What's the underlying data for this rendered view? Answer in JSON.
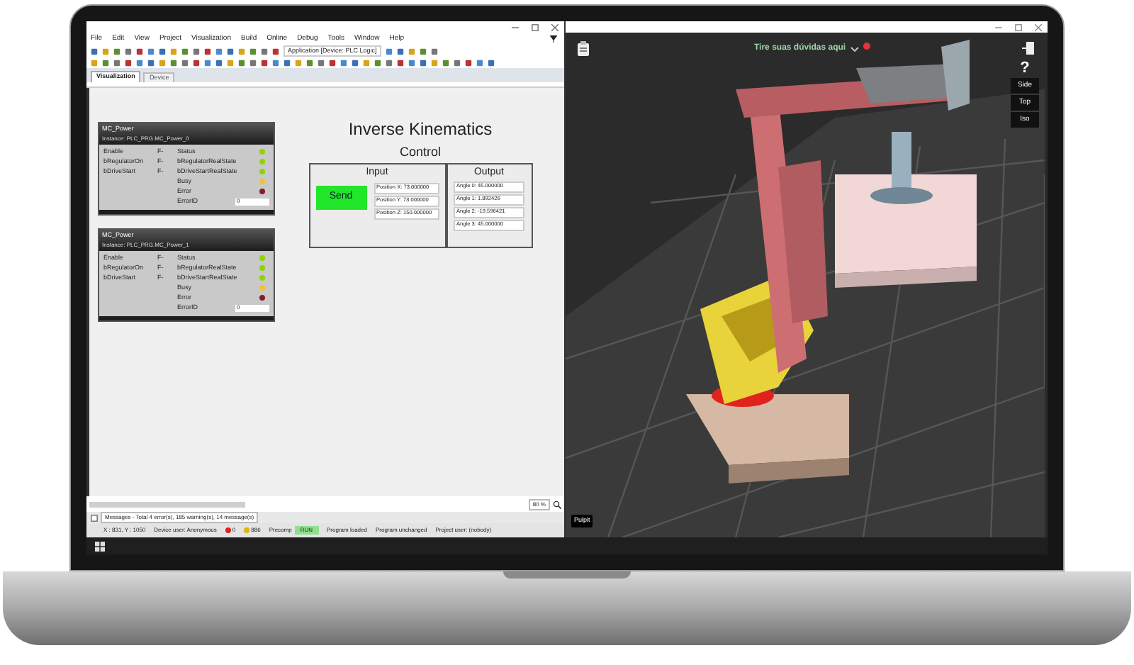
{
  "ide": {
    "menu": [
      "File",
      "Edit",
      "View",
      "Project",
      "Visualization",
      "Build",
      "Online",
      "Debug",
      "Tools",
      "Window",
      "Help"
    ],
    "application": "Application [Device: PLC Logic]",
    "tabs": [
      {
        "label": "Visualization",
        "selected": true
      },
      {
        "label": "Device",
        "selected": false
      }
    ],
    "function_blocks": [
      {
        "title": "MC_Power",
        "instance": "Instance: PLC_PRG.MC_Power_0",
        "inputs": [
          {
            "name": "Enable",
            "value": "F-"
          },
          {
            "name": "bRegulatorOn",
            "value": "F-"
          },
          {
            "name": "bDriveStart",
            "value": "F-"
          }
        ],
        "outputs": [
          {
            "name": "Status",
            "color": "#8fd400"
          },
          {
            "name": "bRegulatorRealState",
            "color": "#8fd400"
          },
          {
            "name": "bDriveStartRealState",
            "color": "#8fd400"
          },
          {
            "name": "Busy",
            "color": "#f2c12e"
          },
          {
            "name": "Error",
            "color": "#8b1a2a"
          }
        ],
        "error_label": "ErrorID",
        "error_value": "0"
      },
      {
        "title": "MC_Power",
        "instance": "Instance: PLC_PRG.MC_Power_1",
        "inputs": [
          {
            "name": "Enable",
            "value": "F-"
          },
          {
            "name": "bRegulatorOn",
            "value": "F-"
          },
          {
            "name": "bDriveStart",
            "value": "F-"
          }
        ],
        "outputs": [
          {
            "name": "Status",
            "color": "#8fd400"
          },
          {
            "name": "bRegulatorRealState",
            "color": "#8fd400"
          },
          {
            "name": "bDriveStartRealState",
            "color": "#8fd400"
          },
          {
            "name": "Busy",
            "color": "#f2c12e"
          },
          {
            "name": "Error",
            "color": "#8b1a2a"
          }
        ],
        "error_label": "ErrorID",
        "error_value": "0"
      }
    ],
    "visualization": {
      "title": "Inverse Kinematics",
      "subtitle": "Control",
      "input_label": "Input",
      "send_button": "Send",
      "positions": [
        "Position X: 73.000000",
        "Position Y: 73.000000",
        "Position Z: 150.000000"
      ],
      "output_label": "Output",
      "angles": [
        "Angle 0: 45.000000",
        "Angle 1: 1.892426",
        "Angle 2: -19.596421",
        "Angle 3: 45.000000"
      ]
    },
    "zoom": "80 %",
    "messages": "Messages - Total 4 error(s), 185 warning(s), 14 message(s)",
    "status_bar": {
      "position": "X : 831, Y : 1050",
      "device_user": "Device user: Anonymous",
      "errors": "0",
      "warnings": "886",
      "precompile": "Precomp",
      "run_state": "RUN",
      "program_state": "Program loaded",
      "change_state": "Program unchanged",
      "project_user": "Project user: (nobody)"
    }
  },
  "simulator": {
    "hint": "Tire suas dúvidas aqui",
    "help": "?",
    "views": [
      "Side",
      "Top",
      "Iso"
    ],
    "scene_label": "Pulpit"
  }
}
